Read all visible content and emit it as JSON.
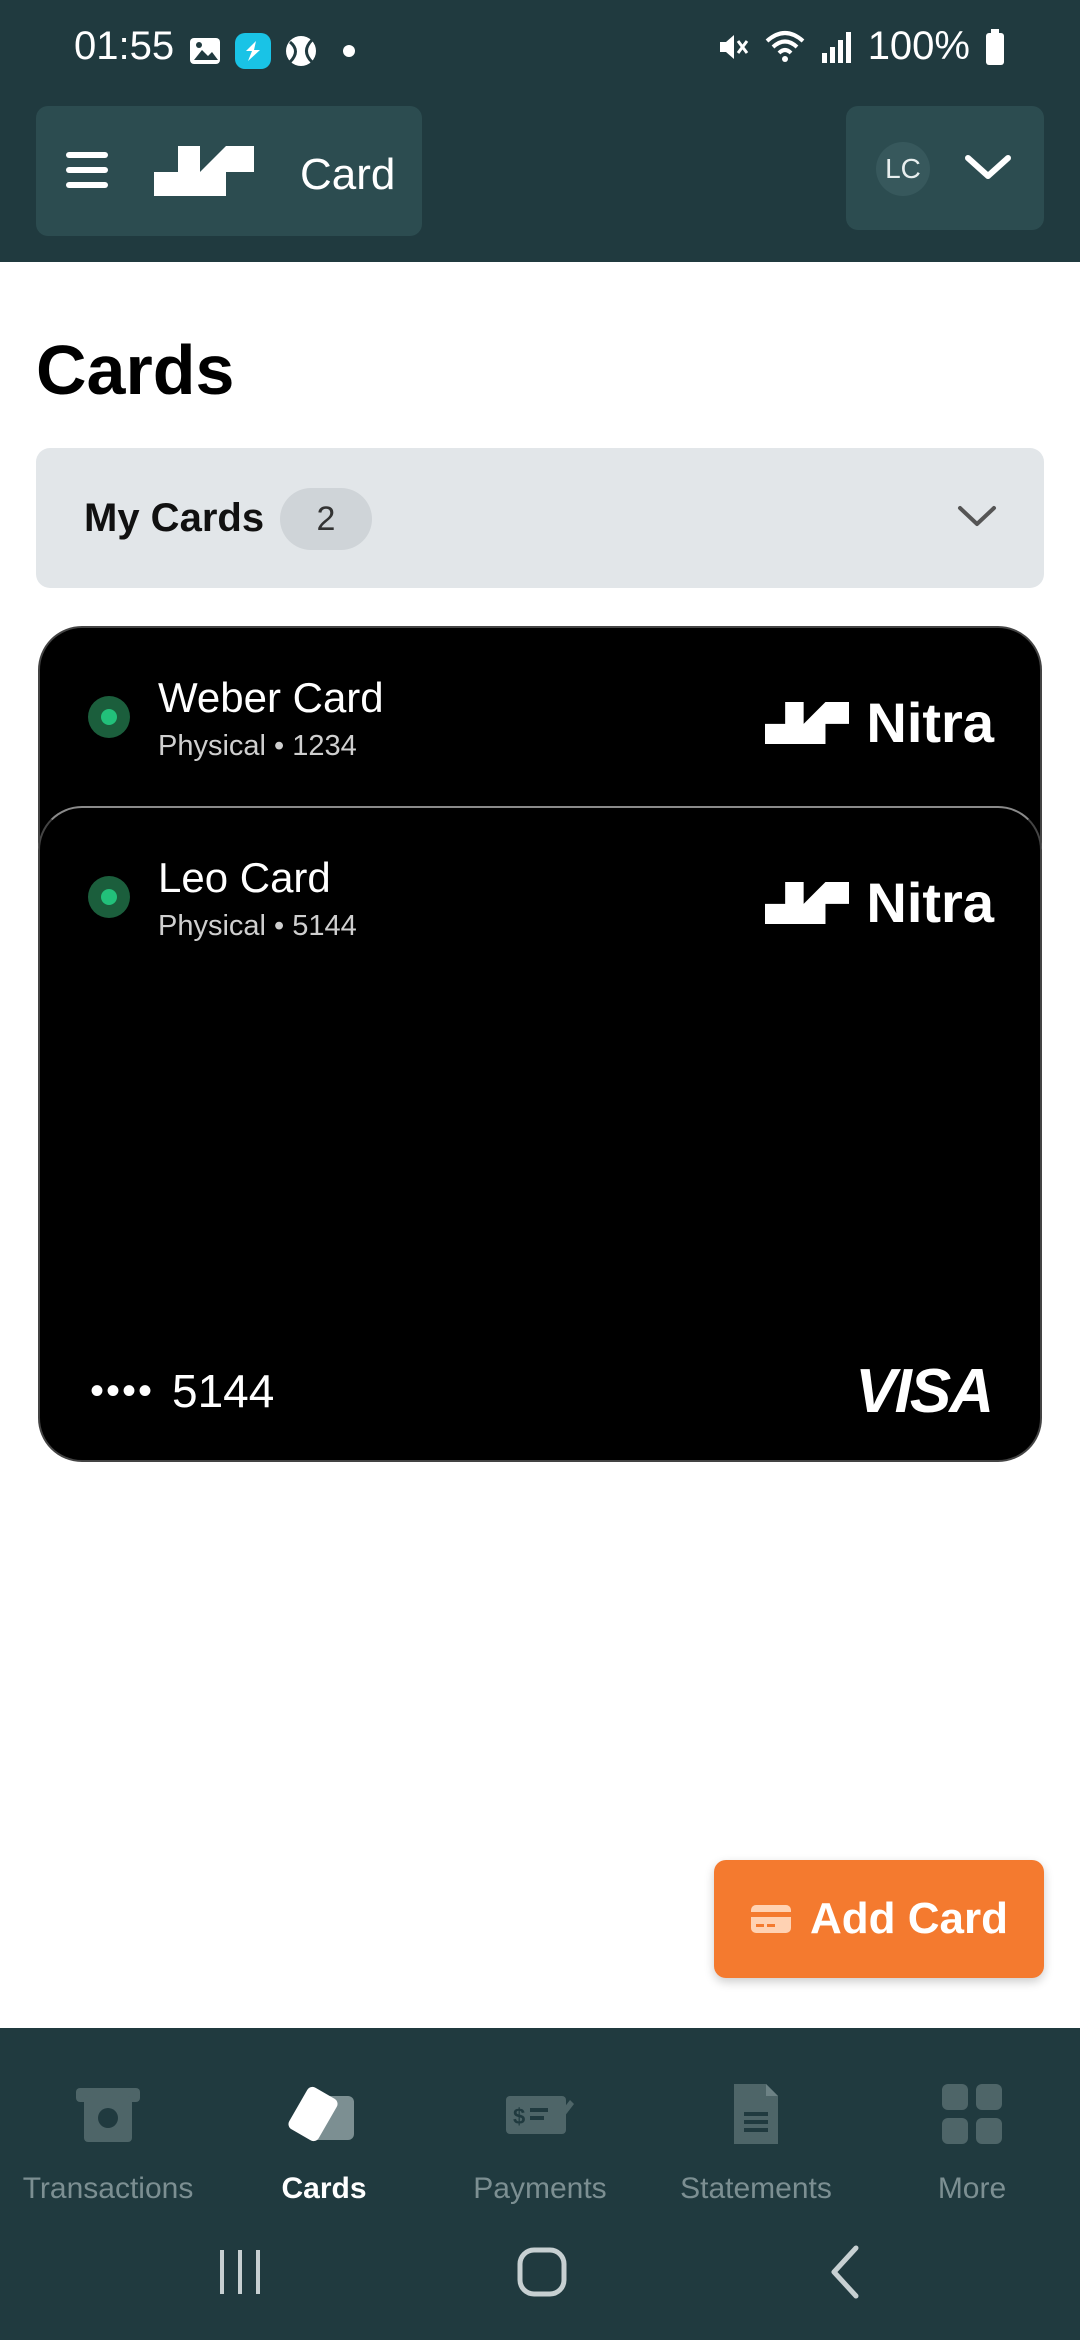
{
  "status_bar": {
    "time": "01:55",
    "battery": "100%",
    "left_icons": [
      "image-icon",
      "shazam-icon",
      "sports-icon",
      "dot-icon"
    ],
    "right_icons": [
      "mute-icon",
      "wifi-icon",
      "signal-icon",
      "battery-icon"
    ]
  },
  "appbar": {
    "title": "Card",
    "avatar_initials": "LC"
  },
  "page": {
    "title": "Cards"
  },
  "my_cards": {
    "label": "My Cards",
    "count": "2"
  },
  "cards": [
    {
      "name": "Weber Card",
      "subtitle": "Physical • 1234",
      "brand": "Nitra"
    },
    {
      "name": "Leo Card",
      "subtitle": "Physical • 5144",
      "brand": "Nitra",
      "masked": "••••",
      "last4": "5144",
      "network": "VISA"
    }
  ],
  "fab": {
    "label": "Add Card"
  },
  "bottom_nav": {
    "items": [
      {
        "label": "Transactions",
        "icon": "transactions-icon"
      },
      {
        "label": "Cards",
        "icon": "cards-icon",
        "active": true
      },
      {
        "label": "Payments",
        "icon": "payments-icon"
      },
      {
        "label": "Statements",
        "icon": "statements-icon"
      },
      {
        "label": "More",
        "icon": "more-grid-icon"
      }
    ]
  },
  "colors": {
    "header_bg": "#203a3f",
    "header_tile": "#2c4c50",
    "accent_orange": "#f47a2f",
    "status_green": "#22c07a"
  }
}
